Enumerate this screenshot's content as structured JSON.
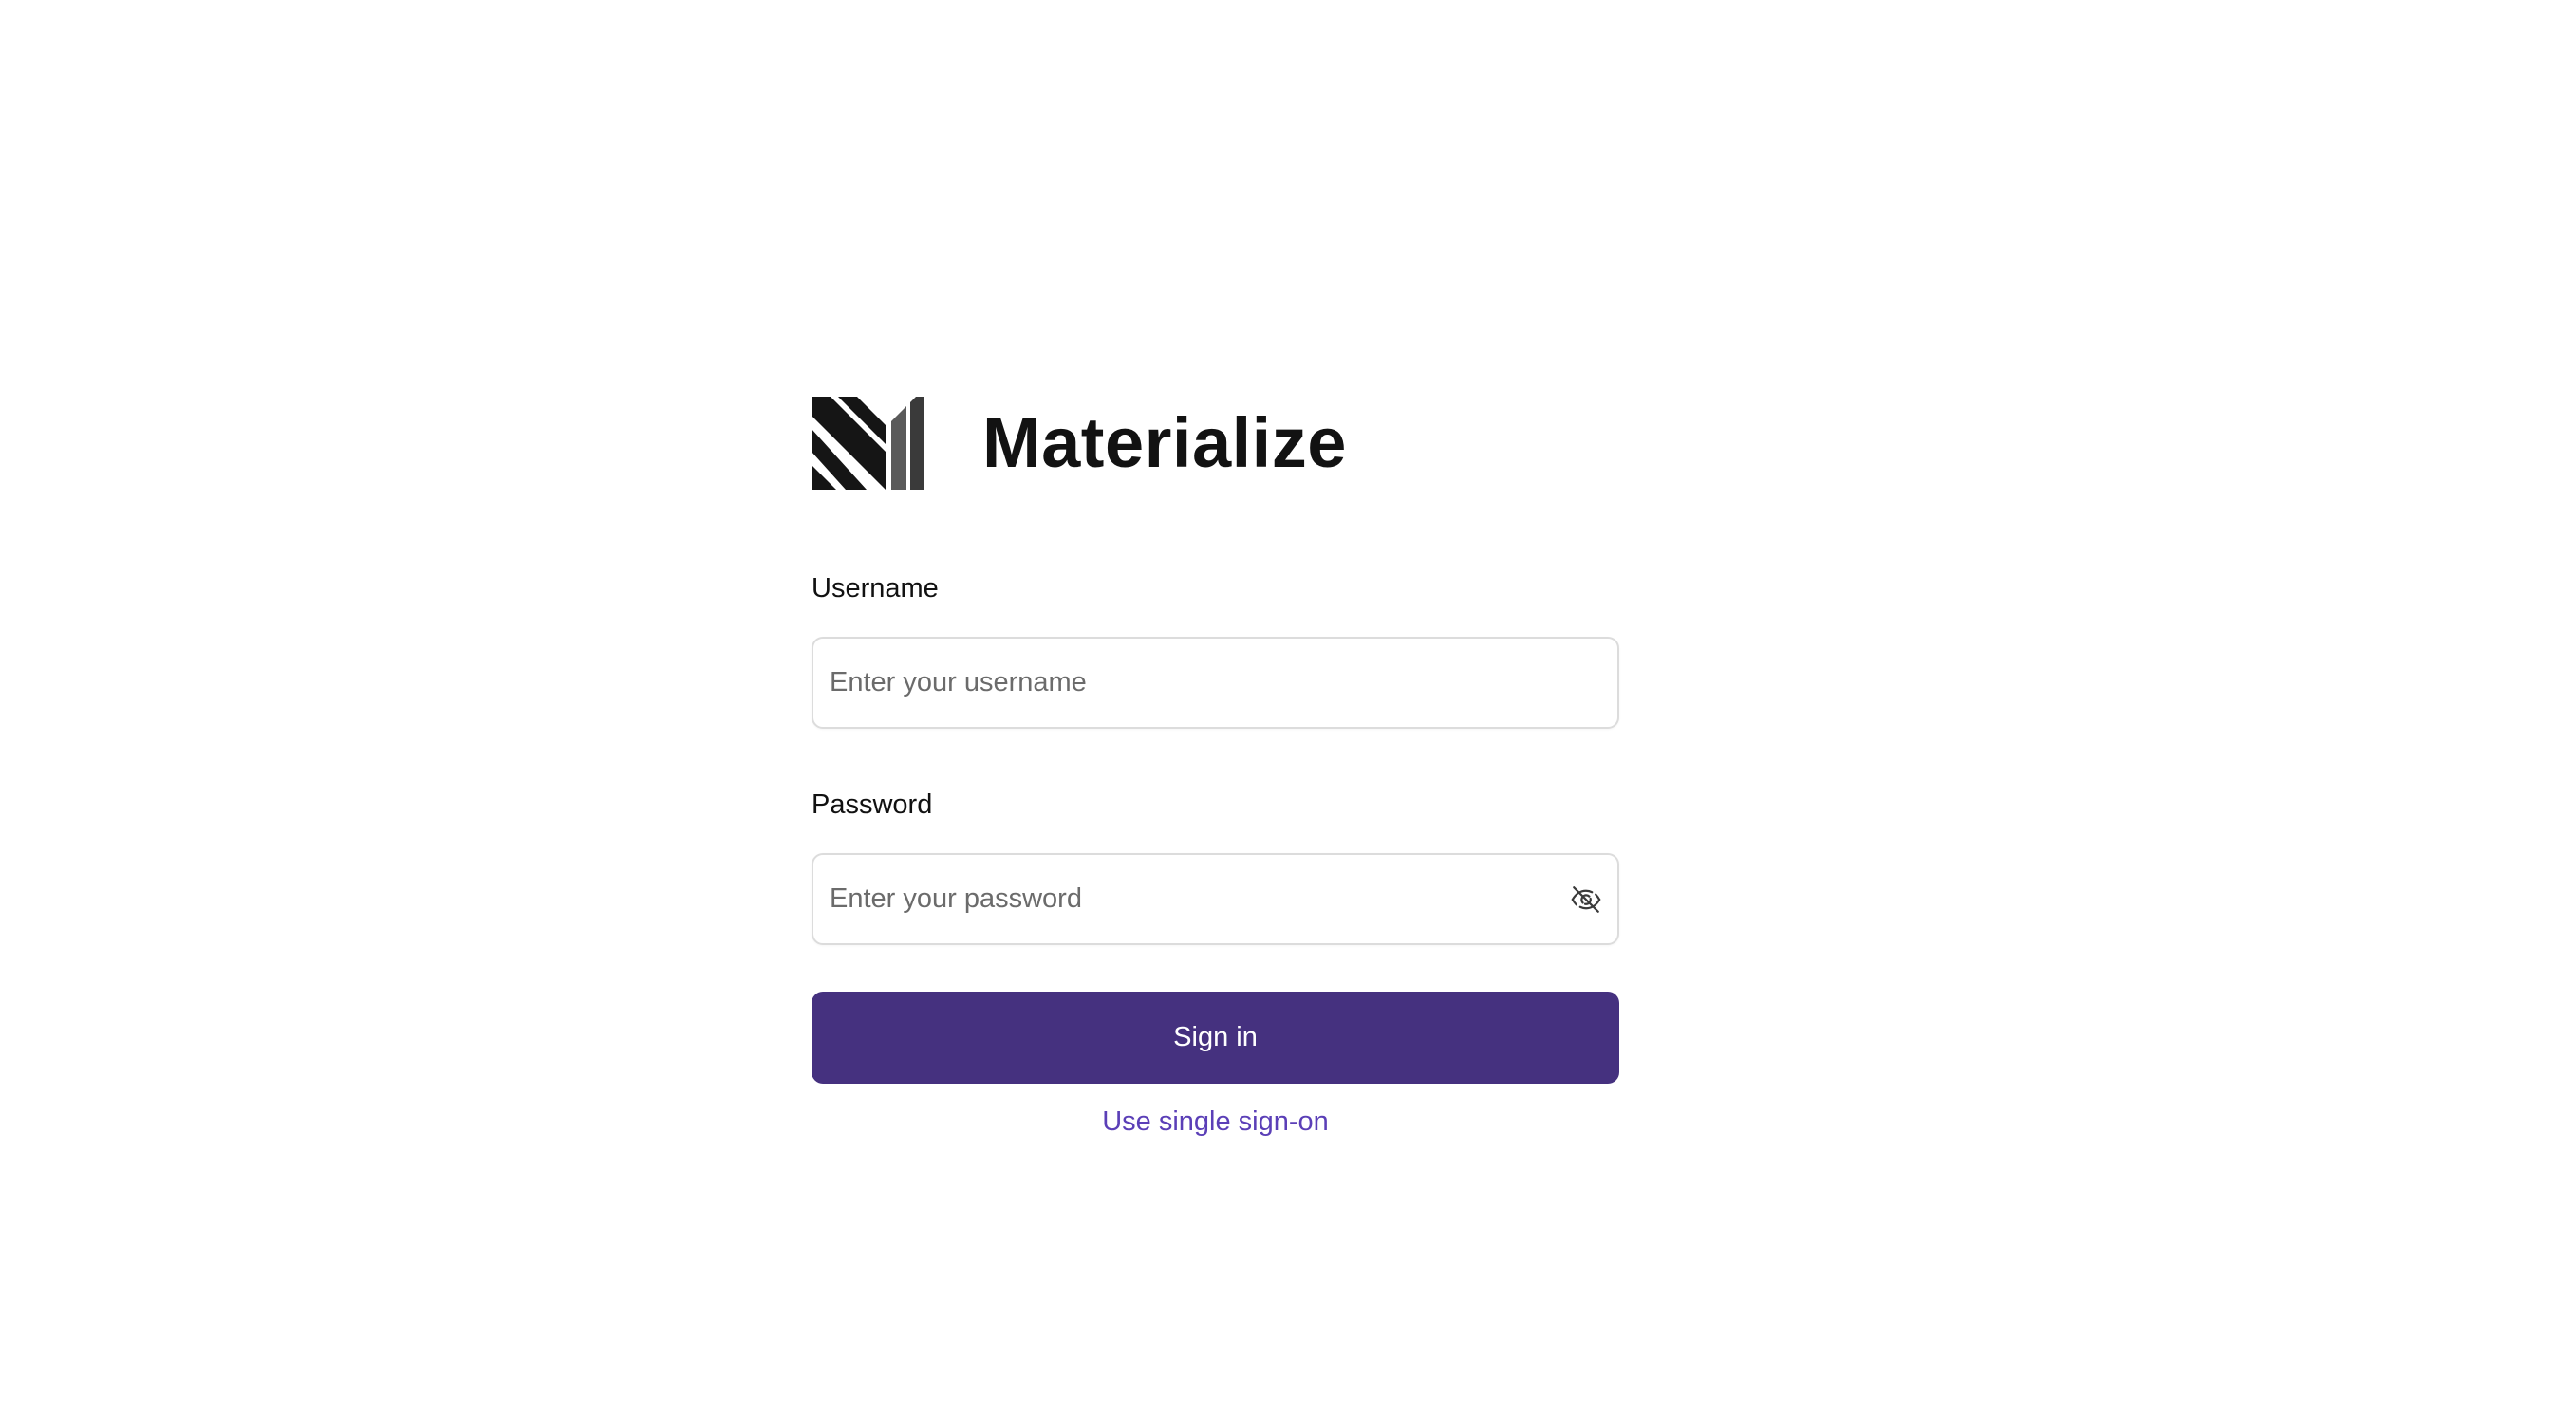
{
  "brand": {
    "name": "Materialize",
    "logo_icon": "materialize-logo"
  },
  "form": {
    "username": {
      "label": "Username",
      "placeholder": "Enter your username",
      "value": ""
    },
    "password": {
      "label": "Password",
      "placeholder": "Enter your password",
      "value": "",
      "toggle_icon": "eye-off-icon"
    },
    "submit_label": "Sign in",
    "sso_link_label": "Use single sign-on"
  },
  "colors": {
    "primary": "#45317f",
    "link": "#5b3fb7",
    "input_border": "#dcdcdc",
    "text": "#111111",
    "placeholder": "#6b6b6b"
  }
}
